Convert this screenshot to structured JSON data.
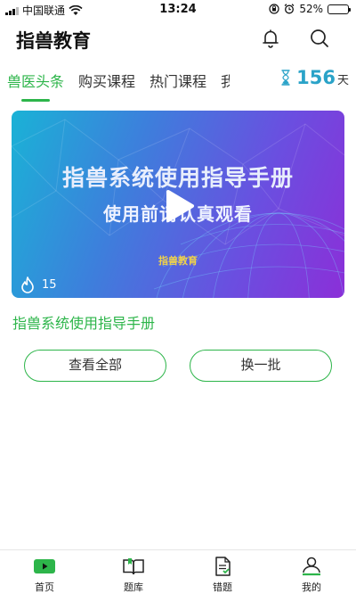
{
  "status_bar": {
    "carrier": "中国联通",
    "time": "13:24",
    "battery": "52%",
    "battery_level": 0.52
  },
  "header": {
    "title": "指兽教育",
    "icons": [
      "bell-icon",
      "search-icon"
    ]
  },
  "tabs": {
    "items": [
      {
        "label": "兽医头条",
        "active": true
      },
      {
        "label": "购买课程",
        "active": false
      },
      {
        "label": "热门课程",
        "active": false
      },
      {
        "label": "我",
        "active": false
      }
    ],
    "countdown_value": "156",
    "countdown_unit": "天"
  },
  "video": {
    "title": "指兽系统使用指导手册",
    "subtitle": "使用前请认真观看",
    "brand": "指兽教育",
    "views": "15",
    "caption": "指兽系统使用指导手册"
  },
  "actions": {
    "view_all": "查看全部",
    "refresh": "换一批"
  },
  "bottom_nav": {
    "items": [
      {
        "label": "首页",
        "icon": "play-icon",
        "active": true
      },
      {
        "label": "题库",
        "icon": "book-icon",
        "active": false
      },
      {
        "label": "错题",
        "icon": "document-icon",
        "active": false
      },
      {
        "label": "我的",
        "icon": "profile-icon",
        "active": false
      }
    ]
  },
  "colors": {
    "accent": "#2db54a",
    "countdown": "#2aa3c8"
  }
}
